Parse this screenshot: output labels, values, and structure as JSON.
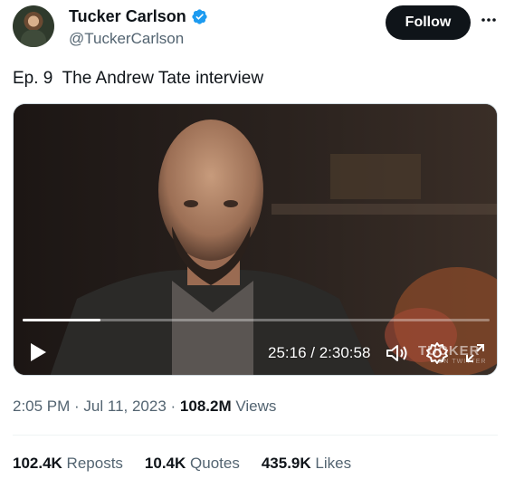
{
  "author": {
    "name": "Tucker Carlson",
    "handle": "@TuckerCarlson",
    "verified_icon": "verified-badge-icon",
    "verified_color": "#1d9bf0"
  },
  "follow_button": {
    "label": "Follow"
  },
  "more_icon": "more-options-icon",
  "tweet": {
    "text": "Ep. 9  The Andrew Tate interview"
  },
  "video": {
    "progress_fraction": 0.166,
    "current_time": "25:16",
    "separator": " / ",
    "duration": "2:30:58",
    "watermark": "TUCKER",
    "watermark_sub": "ON TWITTER",
    "controls": [
      "play-icon",
      "volume-icon",
      "settings-icon",
      "fullscreen-icon"
    ]
  },
  "meta": {
    "time": "2:05 PM",
    "dot1": " · ",
    "date": "Jul 11, 2023",
    "dot2": " · ",
    "views_count": "108.2M",
    "views_label": " Views"
  },
  "stats": {
    "reposts_count": "102.4K",
    "reposts_label": " Reposts",
    "quotes_count": "10.4K",
    "quotes_label": " Quotes",
    "likes_count": "435.9K",
    "likes_label": " Likes"
  }
}
